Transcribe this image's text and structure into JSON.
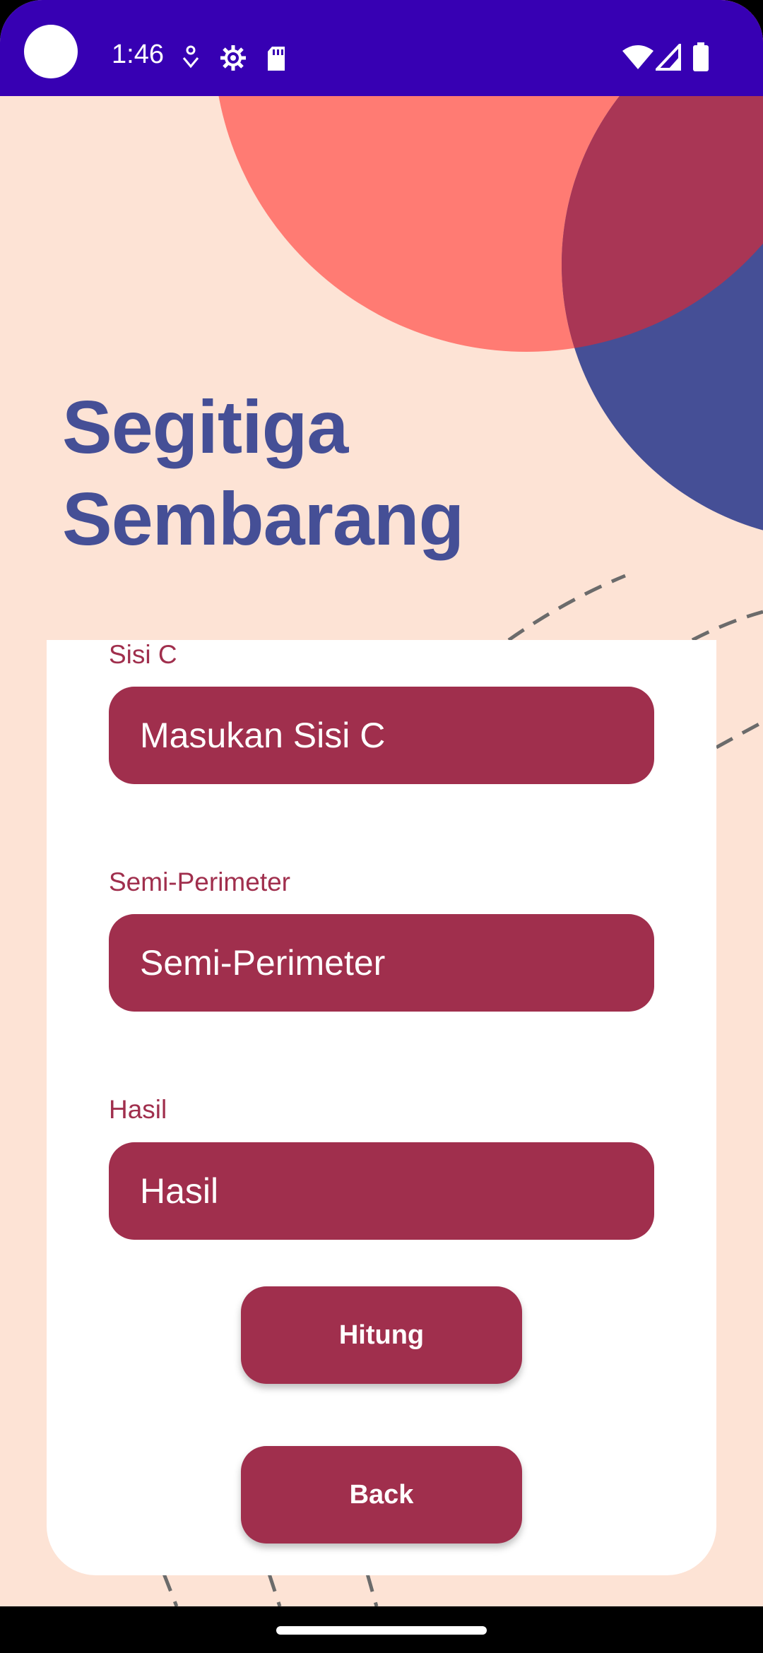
{
  "status_bar": {
    "time": "1:46",
    "left_icons": [
      "notification-dot-icon",
      "gear-icon",
      "sd-card-icon"
    ],
    "right_icons": [
      "wifi-icon",
      "cell-signal-icon",
      "battery-icon"
    ]
  },
  "colors": {
    "status_bar": "#3700b3",
    "background": "#fde3d5",
    "accent": "#a02f4d",
    "title": "#454f96",
    "coral": "#ff7b73",
    "indigo": "#454f96"
  },
  "title": {
    "line1": "Segitiga",
    "line2": "Sembarang"
  },
  "form": {
    "side_c": {
      "label": "Sisi C",
      "value": "",
      "placeholder": "Masukan Sisi C"
    },
    "semi_perimeter": {
      "label": "Semi-Perimeter",
      "value": "",
      "placeholder": "Semi-Perimeter"
    },
    "result": {
      "label": "Hasil",
      "value": "",
      "placeholder": "Hasil"
    },
    "calculate_label": "Hitung",
    "back_label": "Back"
  }
}
